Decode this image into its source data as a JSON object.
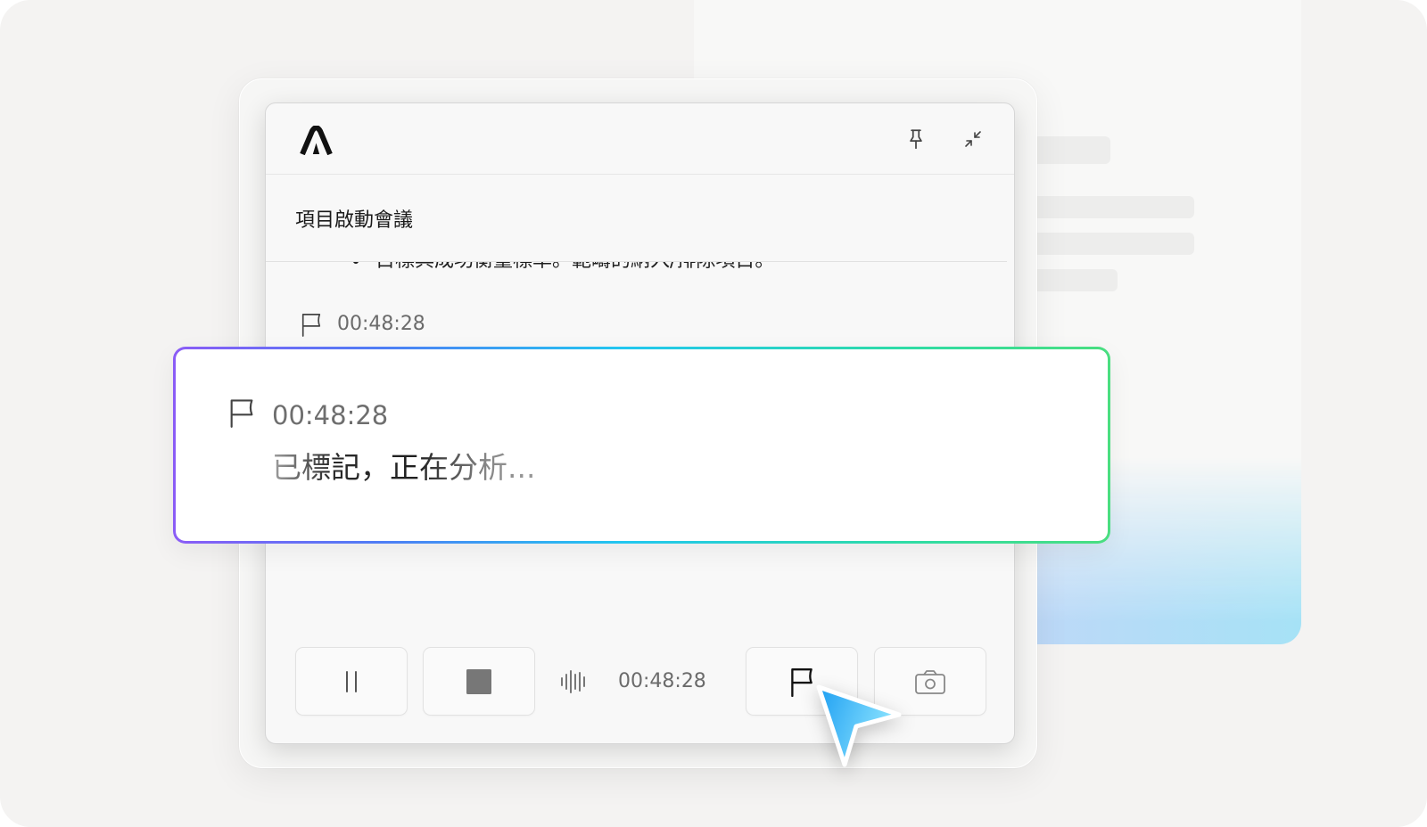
{
  "app": {
    "logo_icon": "app-logo-icon"
  },
  "header": {
    "pin_icon": "pin-icon",
    "collapse_icon": "collapse-icon"
  },
  "meeting": {
    "title": "項目啟動會議"
  },
  "transcript": {
    "partial_line": "目標與成功衡量標準。範疇的納入/排除項目。",
    "marker": {
      "icon": "flag-icon",
      "time": "00:48:28"
    }
  },
  "highlight": {
    "icon": "flag-icon",
    "time": "00:48:28",
    "status": "已標記，正在分析..."
  },
  "controls": {
    "pause_icon": "pause-icon",
    "stop_icon": "stop-icon",
    "waveform_icon": "waveform-icon",
    "timer": "00:48:28",
    "flag_icon": "flag-icon",
    "camera_icon": "camera-icon"
  },
  "colors": {
    "accent_gradient": [
      "#8b5cf6",
      "#4f7df5",
      "#22c7f0",
      "#2fdca6",
      "#4ade80"
    ],
    "cursor_gradient": [
      "#1e9ff2",
      "#8fe6ff"
    ],
    "stop_fill": "#777777",
    "window_bg": "#f8f8f8"
  }
}
